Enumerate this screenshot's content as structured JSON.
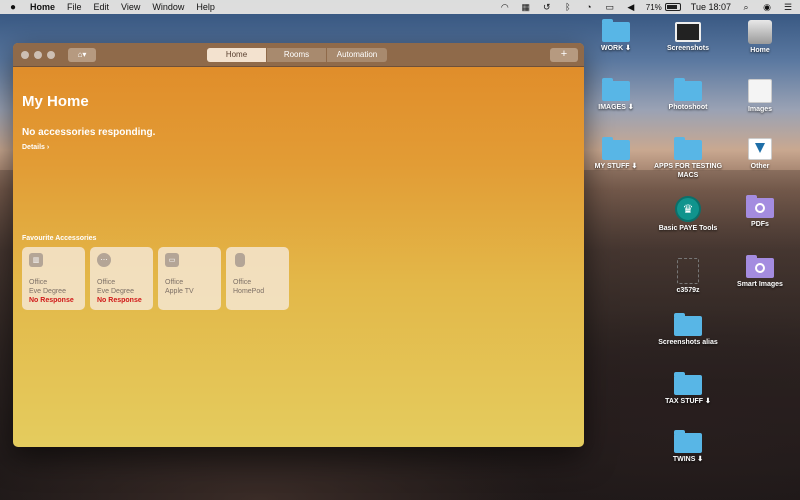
{
  "menubar": {
    "apple_icon": "",
    "app_name": "Home",
    "items": [
      "File",
      "Edit",
      "View",
      "Window",
      "Help"
    ],
    "battery": "71%",
    "clock": "Tue 18:07"
  },
  "window": {
    "segments": [
      "Home",
      "Rooms",
      "Automation"
    ],
    "active_segment": "Home",
    "add_label": "+",
    "home_menu_icon": "house-icon",
    "title": "My Home",
    "status": "No accessories responding.",
    "details": "Details ›",
    "section": "Favourite Accessories",
    "tiles": [
      {
        "room": "Office",
        "name": "Eve Degree",
        "response": "No Response",
        "icon": "sensor-icon"
      },
      {
        "room": "Office",
        "name": "Eve Degree",
        "response": "No Response",
        "icon": "thermometer-icon"
      },
      {
        "room": "Office",
        "name": "Apple TV",
        "response": "",
        "icon": "apple-tv-icon"
      },
      {
        "room": "Office",
        "name": "HomePod",
        "response": "",
        "icon": "homepod-icon"
      }
    ]
  },
  "desktop": [
    {
      "label": "WORK ⬇",
      "type": "folder"
    },
    {
      "label": "Screenshots",
      "type": "screenshot"
    },
    {
      "label": "Home",
      "type": "drive"
    },
    {
      "label": "IMAGES ⬇",
      "type": "folder"
    },
    {
      "label": "Photoshoot",
      "type": "folder"
    },
    {
      "label": "Images",
      "type": "photos"
    },
    {
      "label": "MY STUFF ⬇",
      "type": "folder"
    },
    {
      "label": "APPS FOR TESTING MACS",
      "type": "folder"
    },
    {
      "label": "Other",
      "type": "other"
    },
    {
      "label": "Basic PAYE Tools",
      "type": "crown"
    },
    {
      "label": "PDFs",
      "type": "folder-purple"
    },
    {
      "label": "c3579z",
      "type": "file"
    },
    {
      "label": "Smart Images",
      "type": "folder-purple"
    },
    {
      "label": "Screenshots alias",
      "type": "folder"
    },
    {
      "label": "TAX STUFF ⬇",
      "type": "folder"
    },
    {
      "label": "TWINS ⬇",
      "type": "folder"
    }
  ]
}
